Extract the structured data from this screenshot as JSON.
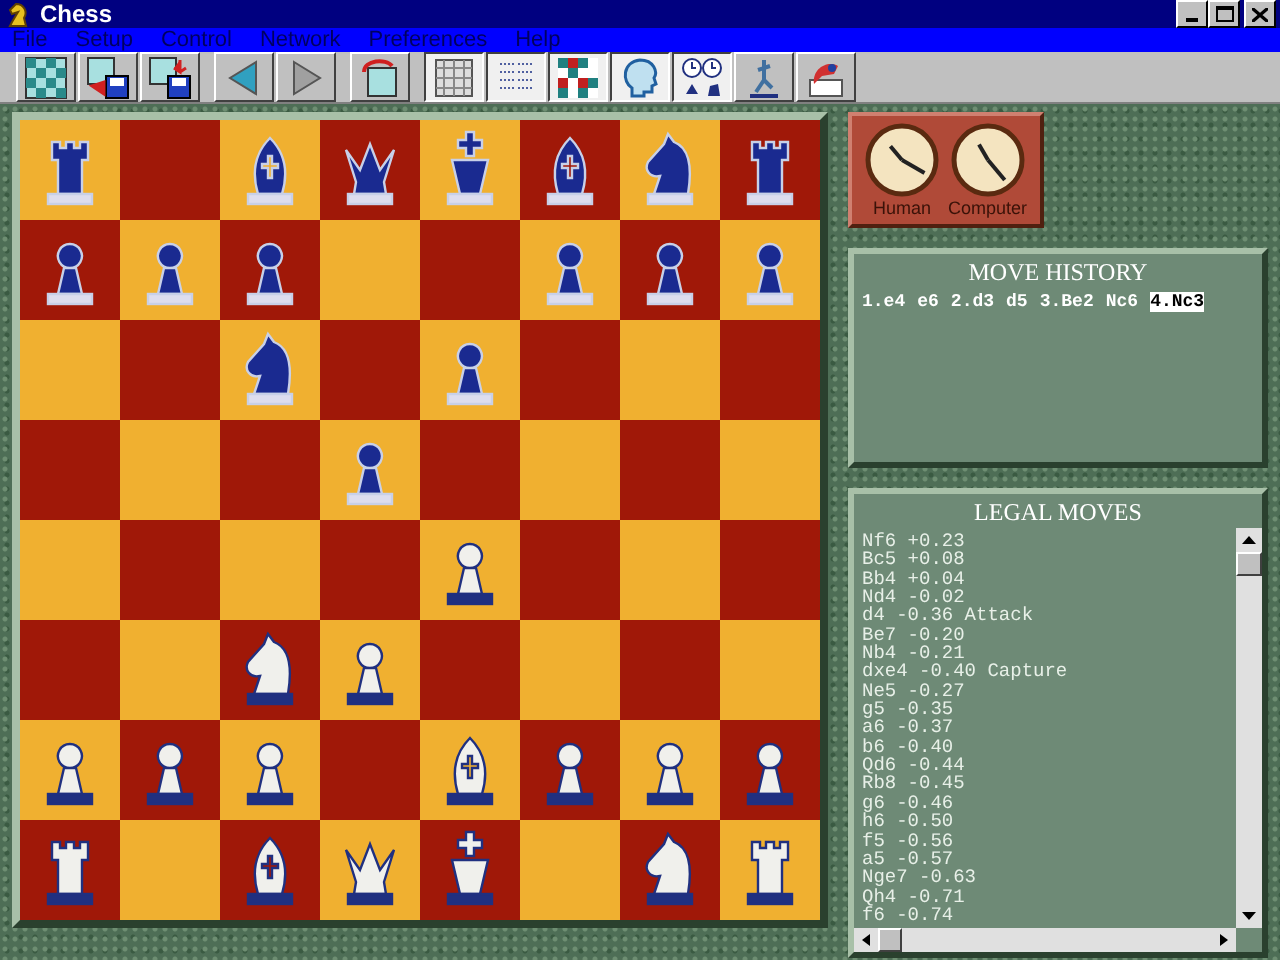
{
  "window": {
    "title": "Chess"
  },
  "menu": [
    "File",
    "Setup",
    "Control",
    "Network",
    "Preferences",
    "Help"
  ],
  "toolbar": [
    {
      "kind": "new",
      "pressed": false
    },
    {
      "kind": "load",
      "pressed": false
    },
    {
      "kind": "save",
      "pressed": false
    },
    {
      "kind": "back",
      "pressed": false
    },
    {
      "kind": "forward",
      "pressed": false
    },
    {
      "kind": "undo",
      "pressed": false
    },
    {
      "kind": "board",
      "pressed": true
    },
    {
      "kind": "list",
      "pressed": true
    },
    {
      "kind": "colors",
      "pressed": true
    },
    {
      "kind": "head",
      "pressed": true
    },
    {
      "kind": "clocks",
      "pressed": true
    },
    {
      "kind": "figure",
      "pressed": false
    },
    {
      "kind": "hint",
      "pressed": false
    }
  ],
  "board": {
    "ranks": [
      [
        {
          "kind": "rook",
          "white": false
        },
        {
          "kind": "empty"
        },
        {
          "kind": "bishop",
          "white": false
        },
        {
          "kind": "queen",
          "white": false
        },
        {
          "kind": "king",
          "white": false
        },
        {
          "kind": "bishop",
          "white": false
        },
        {
          "kind": "knight",
          "white": false
        },
        {
          "kind": "rook",
          "white": false
        }
      ],
      [
        {
          "kind": "pawn",
          "white": false
        },
        {
          "kind": "pawn",
          "white": false
        },
        {
          "kind": "pawn",
          "white": false
        },
        {
          "kind": "empty"
        },
        {
          "kind": "empty"
        },
        {
          "kind": "pawn",
          "white": false
        },
        {
          "kind": "pawn",
          "white": false
        },
        {
          "kind": "pawn",
          "white": false
        }
      ],
      [
        {
          "kind": "empty"
        },
        {
          "kind": "empty"
        },
        {
          "kind": "knight",
          "white": false
        },
        {
          "kind": "empty"
        },
        {
          "kind": "pawn",
          "white": false
        },
        {
          "kind": "empty"
        },
        {
          "kind": "empty"
        },
        {
          "kind": "empty"
        }
      ],
      [
        {
          "kind": "empty"
        },
        {
          "kind": "empty"
        },
        {
          "kind": "empty"
        },
        {
          "kind": "pawn",
          "white": false
        },
        {
          "kind": "empty"
        },
        {
          "kind": "empty"
        },
        {
          "kind": "empty"
        },
        {
          "kind": "empty"
        }
      ],
      [
        {
          "kind": "empty"
        },
        {
          "kind": "empty"
        },
        {
          "kind": "empty"
        },
        {
          "kind": "empty"
        },
        {
          "kind": "pawn",
          "white": true
        },
        {
          "kind": "empty"
        },
        {
          "kind": "empty"
        },
        {
          "kind": "empty"
        }
      ],
      [
        {
          "kind": "empty"
        },
        {
          "kind": "empty"
        },
        {
          "kind": "knight",
          "white": true
        },
        {
          "kind": "pawn",
          "white": true
        },
        {
          "kind": "empty"
        },
        {
          "kind": "empty"
        },
        {
          "kind": "empty"
        },
        {
          "kind": "empty"
        }
      ],
      [
        {
          "kind": "pawn",
          "white": true
        },
        {
          "kind": "pawn",
          "white": true
        },
        {
          "kind": "pawn",
          "white": true
        },
        {
          "kind": "empty"
        },
        {
          "kind": "bishop",
          "white": true
        },
        {
          "kind": "pawn",
          "white": true
        },
        {
          "kind": "pawn",
          "white": true
        },
        {
          "kind": "pawn",
          "white": true
        }
      ],
      [
        {
          "kind": "rook",
          "white": true
        },
        {
          "kind": "empty"
        },
        {
          "kind": "bishop",
          "white": true
        },
        {
          "kind": "queen",
          "white": true
        },
        {
          "kind": "king",
          "white": true
        },
        {
          "kind": "empty"
        },
        {
          "kind": "knight",
          "white": true
        },
        {
          "kind": "rook",
          "white": true
        }
      ]
    ]
  },
  "clocks": [
    {
      "label": "Human"
    },
    {
      "label": "Computer"
    }
  ],
  "move_history": {
    "title": "MOVE HISTORY",
    "moves": [
      {
        "text": "1.e4",
        "selected": false
      },
      {
        "text": "e6",
        "selected": false
      },
      {
        "text": "2.d3",
        "selected": false
      },
      {
        "text": "d5",
        "selected": false
      },
      {
        "text": "3.Be2",
        "selected": false
      },
      {
        "text": "Nc6",
        "selected": false
      },
      {
        "text": "4.Nc3",
        "selected": true
      }
    ]
  },
  "legal_moves": {
    "title": "LEGAL MOVES",
    "items": [
      "Nf6 +0.23",
      "Bc5 +0.08",
      "Bb4 +0.04",
      "Nd4 -0.02",
      "d4 -0.36 Attack",
      "Be7 -0.20",
      "Nb4 -0.21",
      "dxe4 -0.40 Capture",
      "Ne5 -0.27",
      "g5 -0.35",
      "a6 -0.37",
      "b6 -0.40",
      "Qd6 -0.44",
      "Rb8 -0.45",
      "g6 -0.46",
      "h6 -0.50",
      "f5 -0.56",
      "a5 -0.57",
      "Nge7 -0.63",
      "Qh4 -0.71",
      "f6 -0.74"
    ]
  }
}
